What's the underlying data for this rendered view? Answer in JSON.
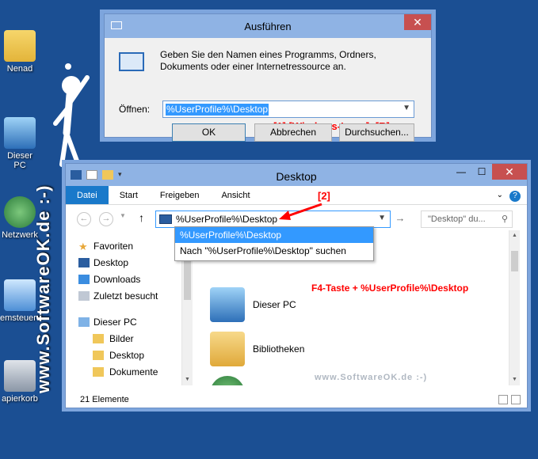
{
  "desktop": {
    "icons": [
      {
        "label": "Nenad"
      },
      {
        "label": "Dieser PC"
      },
      {
        "label": "Netzwerk"
      },
      {
        "label": "emsteueru"
      },
      {
        "label": "apierkorb"
      }
    ],
    "watermark_vertical": "www.SoftwareOK.de :-)"
  },
  "run": {
    "title": "Ausführen",
    "close": "✕",
    "description": "Geben Sie den Namen eines Programms, Ordners, Dokuments oder einer Internetressource an.",
    "open_label": "Öffnen:",
    "input_value": "%UserProfile%\\Desktop",
    "annotation": "[1] [Windows-Logo]+[R]",
    "ok": "OK",
    "cancel": "Abbrechen",
    "browse": "Durchsuchen..."
  },
  "explorer": {
    "title": "Desktop",
    "tabs": [
      "Datei",
      "Start",
      "Freigeben",
      "Ansicht"
    ],
    "address_value": "%UserProfile%\\Desktop",
    "search_placeholder": "\"Desktop\" du...",
    "annotation_arrow": "[2]",
    "suggestions": [
      "%UserProfile%\\Desktop",
      "Nach \"%UserProfile%\\Desktop\" suchen"
    ],
    "nav": {
      "favorites": "Favoriten",
      "fav_items": [
        "Desktop",
        "Downloads",
        "Zuletzt besucht"
      ],
      "this_pc": "Dieser PC",
      "pc_items": [
        "Bilder",
        "Desktop",
        "Dokumente"
      ]
    },
    "content_items": [
      "Dieser PC",
      "Bibliotheken"
    ],
    "f4_note": "F4-Taste + %UserProfile%\\Desktop",
    "watermark": "www.SoftwareOK.de :-)",
    "status": "21 Elemente"
  }
}
